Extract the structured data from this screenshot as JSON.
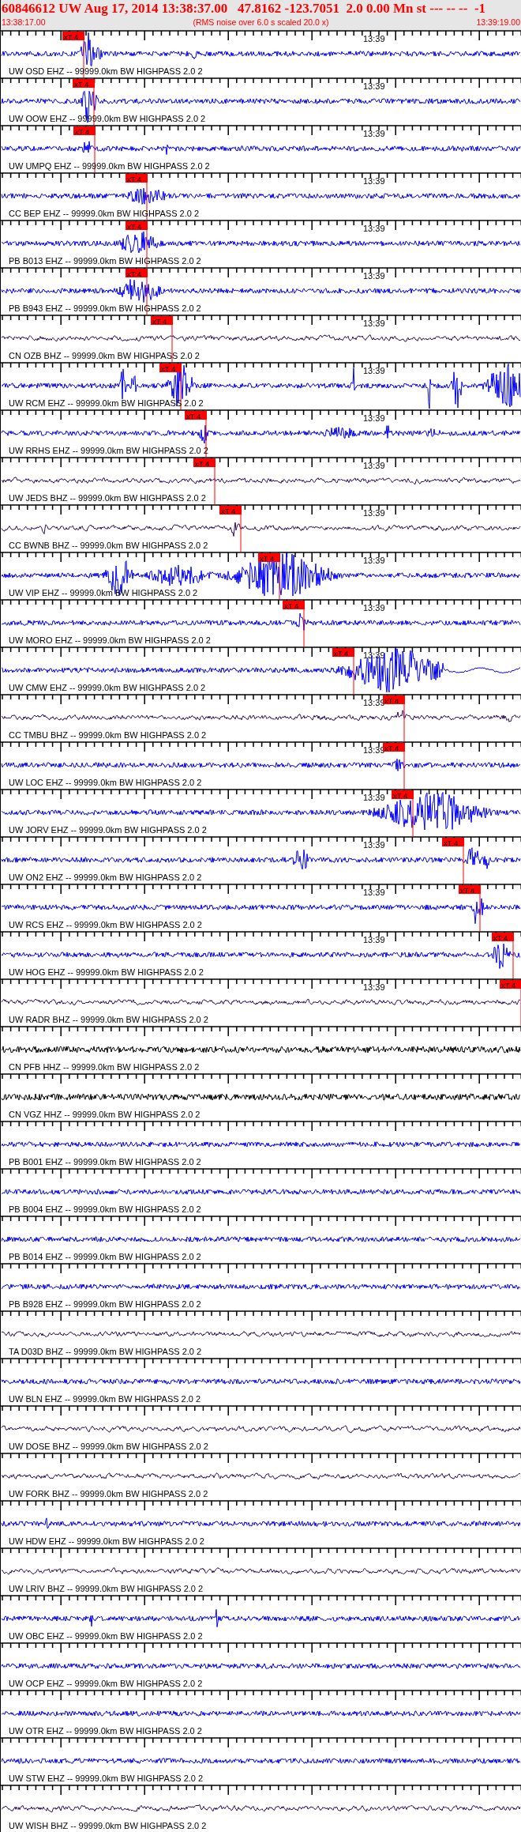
{
  "header": {
    "title": "60846612 UW Aug 17, 2014 13:38:37.00   47.8162 -123.7051  2.0 0.00 Mn st --- -- --  -1",
    "start_time": "13:38:17.00",
    "note": "(RMS noise over 6.0 s scaled 20.0 x)",
    "end_time": "13:39:19.00"
  },
  "traces": [
    {
      "label": "UW OSD EHZ -- 99999.0km BW HIGHPASS 2.0 2",
      "color": "#0000ff",
      "time_mark": "13:39",
      "pick": "xT 4"
    },
    {
      "label": "UW OOW EHZ -- 99999.0km BW HIGHPASS 2.0 2",
      "color": "#0000ff",
      "time_mark": "13:39",
      "pick": "xT 4"
    },
    {
      "label": "UW UMPQ EHZ -- 99999.0km BW HIGHPASS 2.0 2",
      "color": "#0000ff",
      "time_mark": "13:39",
      "pick": "xT 4"
    },
    {
      "label": "CC BEP EHZ -- 99999.0km BW HIGHPASS 2.0 2",
      "color": "#0000ff",
      "time_mark": "13:39",
      "pick": "xT 4"
    },
    {
      "label": "PB B013 EHZ -- 99999.0km BW HIGHPASS 2.0 2",
      "color": "#0000ff",
      "time_mark": "13:39",
      "pick": "xT 4"
    },
    {
      "label": "PB B943 EHZ -- 99999.0km BW HIGHPASS 2.0 2",
      "color": "#0000ff",
      "time_mark": "13:39",
      "pick": "xT 4"
    },
    {
      "label": "CN OZB BHZ -- 99999.0km BW HIGHPASS 2.0 2",
      "color": "#2b0a5a",
      "time_mark": "13:39",
      "pick": "xT 4"
    },
    {
      "label": "UW RCM EHZ -- 99999.0km BW HIGHPASS 2.0 2",
      "color": "#0000ff",
      "time_mark": "13:39",
      "pick": "xT 4"
    },
    {
      "label": "UW RRHS EHZ -- 99999.0km BW HIGHPASS 2.0 2",
      "color": "#0000ff",
      "time_mark": "13:39",
      "pick": "xT 4"
    },
    {
      "label": "UW JEDS BHZ -- 99999.0km BW HIGHPASS 2.0 2",
      "color": "#2b0a5a",
      "time_mark": "13:39",
      "pick": "xT 4"
    },
    {
      "label": "CC BWNB BHZ -- 99999.0km BW HIGHPASS 2.0 2",
      "color": "#2b0a5a",
      "time_mark": "13:39",
      "pick": "xT 4"
    },
    {
      "label": "UW VIP EHZ -- 99999.0km BW HIGHPASS 2.0 2",
      "color": "#0000ff",
      "time_mark": "13:39",
      "pick": "xT 4"
    },
    {
      "label": "UW MORO EHZ -- 99999.0km BW HIGHPASS 2.0 2",
      "color": "#0000ff",
      "time_mark": "13:39",
      "pick": "xT 4"
    },
    {
      "label": "UW CMW EHZ -- 99999.0km BW HIGHPASS 2.0 2",
      "color": "#0000ff",
      "time_mark": "13:39",
      "pick": "xT 4"
    },
    {
      "label": "CC TMBU BHZ -- 99999.0km BW HIGHPASS 2.0 2",
      "color": "#2b0a5a",
      "time_mark": "13:39",
      "pick": "xT 4"
    },
    {
      "label": "UW LOC EHZ -- 99999.0km BW HIGHPASS 2.0 2",
      "color": "#0000ff",
      "time_mark": "13:39",
      "pick": "xT 4"
    },
    {
      "label": "UW JORV EHZ -- 99999.0km BW HIGHPASS 2.0 2",
      "color": "#0000ff",
      "time_mark": "13:39",
      "pick": "xT 4"
    },
    {
      "label": "UW ON2 EHZ -- 99999.0km BW HIGHPASS 2.0 2",
      "color": "#0000ff",
      "time_mark": "13:39",
      "pick": "xT 4"
    },
    {
      "label": "UW RCS EHZ -- 99999.0km BW HIGHPASS 2.0 2",
      "color": "#0000ff",
      "time_mark": "13:39",
      "pick": "xT 4"
    },
    {
      "label": "UW HOG EHZ -- 99999.0km BW HIGHPASS 2.0 2",
      "color": "#0000ff",
      "time_mark": "13:39",
      "pick": "xT 4"
    },
    {
      "label": "UW RADR BHZ -- 99999.0km BW HIGHPASS 2.0 2",
      "color": "#2b0a5a",
      "time_mark": "13:39",
      "pick": "xT 4"
    },
    {
      "label": "CN PFB HHZ -- 99999.0km BW HIGHPASS 2.0 2",
      "color": "#000000"
    },
    {
      "label": "CN VGZ HHZ -- 99999.0km BW HIGHPASS 2.0 2",
      "color": "#000000"
    },
    {
      "label": "PB B001 EHZ -- 99999.0km BW HIGHPASS 2.0 2",
      "color": "#0000ff"
    },
    {
      "label": "PB B004 EHZ -- 99999.0km BW HIGHPASS 2.0 2",
      "color": "#0000ff"
    },
    {
      "label": "PB B014 EHZ -- 99999.0km BW HIGHPASS 2.0 2",
      "color": "#0000ff"
    },
    {
      "label": "PB B928 EHZ -- 99999.0km BW HIGHPASS 2.0 2",
      "color": "#0000ff"
    },
    {
      "label": "TA D03D BHZ -- 99999.0km BW HIGHPASS 2.0 2",
      "color": "#2b0a5a"
    },
    {
      "label": "UW BLN EHZ -- 99999.0km BW HIGHPASS 2.0 2",
      "color": "#0000ff"
    },
    {
      "label": "UW DOSE BHZ -- 99999.0km BW HIGHPASS 2.0 2",
      "color": "#2b0a5a"
    },
    {
      "label": "UW FORK BHZ -- 99999.0km BW HIGHPASS 2.0 2",
      "color": "#2b0a5a"
    },
    {
      "label": "UW HDW EHZ -- 99999.0km BW HIGHPASS 2.0 2",
      "color": "#0000ff"
    },
    {
      "label": "UW LRIV BHZ -- 99999.0km BW HIGHPASS 2.0 2",
      "color": "#2b0a5a"
    },
    {
      "label": "UW OBC EHZ -- 99999.0km BW HIGHPASS 2.0 2",
      "color": "#0000ff"
    },
    {
      "label": "UW OCP EHZ -- 99999.0km BW HIGHPASS 2.0 2",
      "color": "#0000ff"
    },
    {
      "label": "UW OTR EHZ -- 99999.0km BW HIGHPASS 2.0 2",
      "color": "#0000ff"
    },
    {
      "label": "UW STW EHZ -- 99999.0km BW HIGHPASS 2.0 2",
      "color": "#0000ff"
    },
    {
      "label": "UW WISH BHZ -- 99999.0km BW HIGHPASS 2.0 2",
      "color": "#2b0a5a"
    }
  ]
}
